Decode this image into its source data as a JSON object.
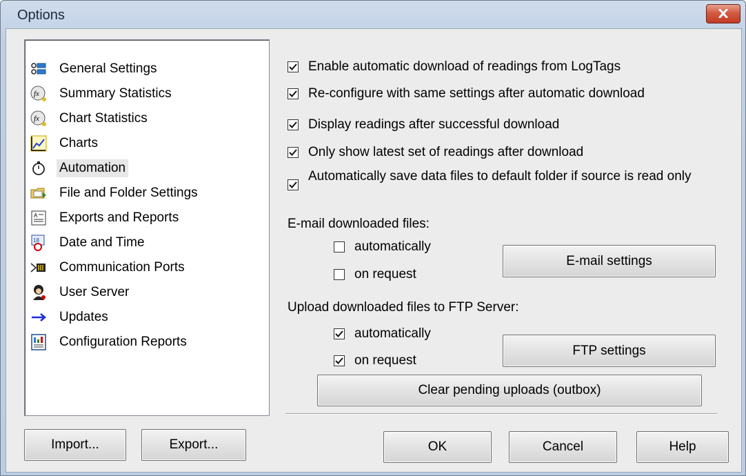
{
  "window": {
    "title": "Options"
  },
  "sidebar": {
    "items": [
      {
        "label": "General Settings",
        "icon": "settings-icon"
      },
      {
        "label": "Summary Statistics",
        "icon": "fx-icon"
      },
      {
        "label": "Chart Statistics",
        "icon": "fx-icon"
      },
      {
        "label": "Charts",
        "icon": "chart-icon"
      },
      {
        "label": "Automation",
        "icon": "stopwatch-icon",
        "selected": true
      },
      {
        "label": "File and Folder Settings",
        "icon": "folder-icon"
      },
      {
        "label": "Exports and Reports",
        "icon": "report-icon"
      },
      {
        "label": "Date and Time",
        "icon": "calendar-clock-icon"
      },
      {
        "label": "Communication Ports",
        "icon": "port-icon"
      },
      {
        "label": "User Server",
        "icon": "user-server-icon"
      },
      {
        "label": "Updates",
        "icon": "arrow-right-icon"
      },
      {
        "label": "Configuration Reports",
        "icon": "config-report-icon"
      }
    ]
  },
  "automation": {
    "options": [
      {
        "label": "Enable automatic download of readings from LogTags",
        "checked": true
      },
      {
        "label": "Re-configure with same settings after automatic download",
        "checked": true
      },
      {
        "label": "Display readings after successful download",
        "checked": true
      },
      {
        "label": "Only show latest set of readings after download",
        "checked": true
      },
      {
        "label": "Automatically save data files to default folder if source is read only",
        "checked": true
      }
    ],
    "email": {
      "heading": "E-mail downloaded files:",
      "automatically": {
        "label": "automatically",
        "checked": false
      },
      "on_request": {
        "label": "on request",
        "checked": false
      },
      "settings_button": "E-mail settings"
    },
    "ftp": {
      "heading": "Upload downloaded files to FTP Server:",
      "automatically": {
        "label": "automatically",
        "checked": true
      },
      "on_request": {
        "label": "on request",
        "checked": true
      },
      "settings_button": "FTP settings"
    },
    "clear_button": "Clear pending uploads (outbox)"
  },
  "footer": {
    "import": "Import...",
    "export": "Export...",
    "ok": "OK",
    "cancel": "Cancel",
    "help": "Help"
  }
}
